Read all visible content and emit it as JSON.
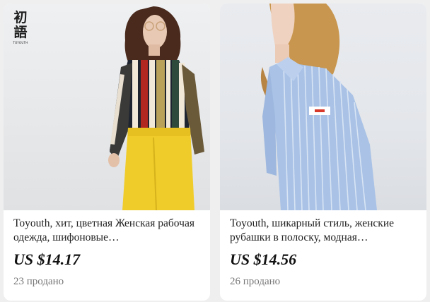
{
  "products": [
    {
      "title": "Toyouth, хит, цветная Женская рабочая одежда, шифоновые…",
      "price": "US $14.17",
      "sold": "23 продано",
      "logo_glyphs": "初語",
      "logo_brand": "TOYOUTH"
    },
    {
      "title": "Toyouth, шикарный стиль, женские рубашки в полоску, модная…",
      "price": "US $14.56",
      "sold": "26 продано"
    }
  ]
}
